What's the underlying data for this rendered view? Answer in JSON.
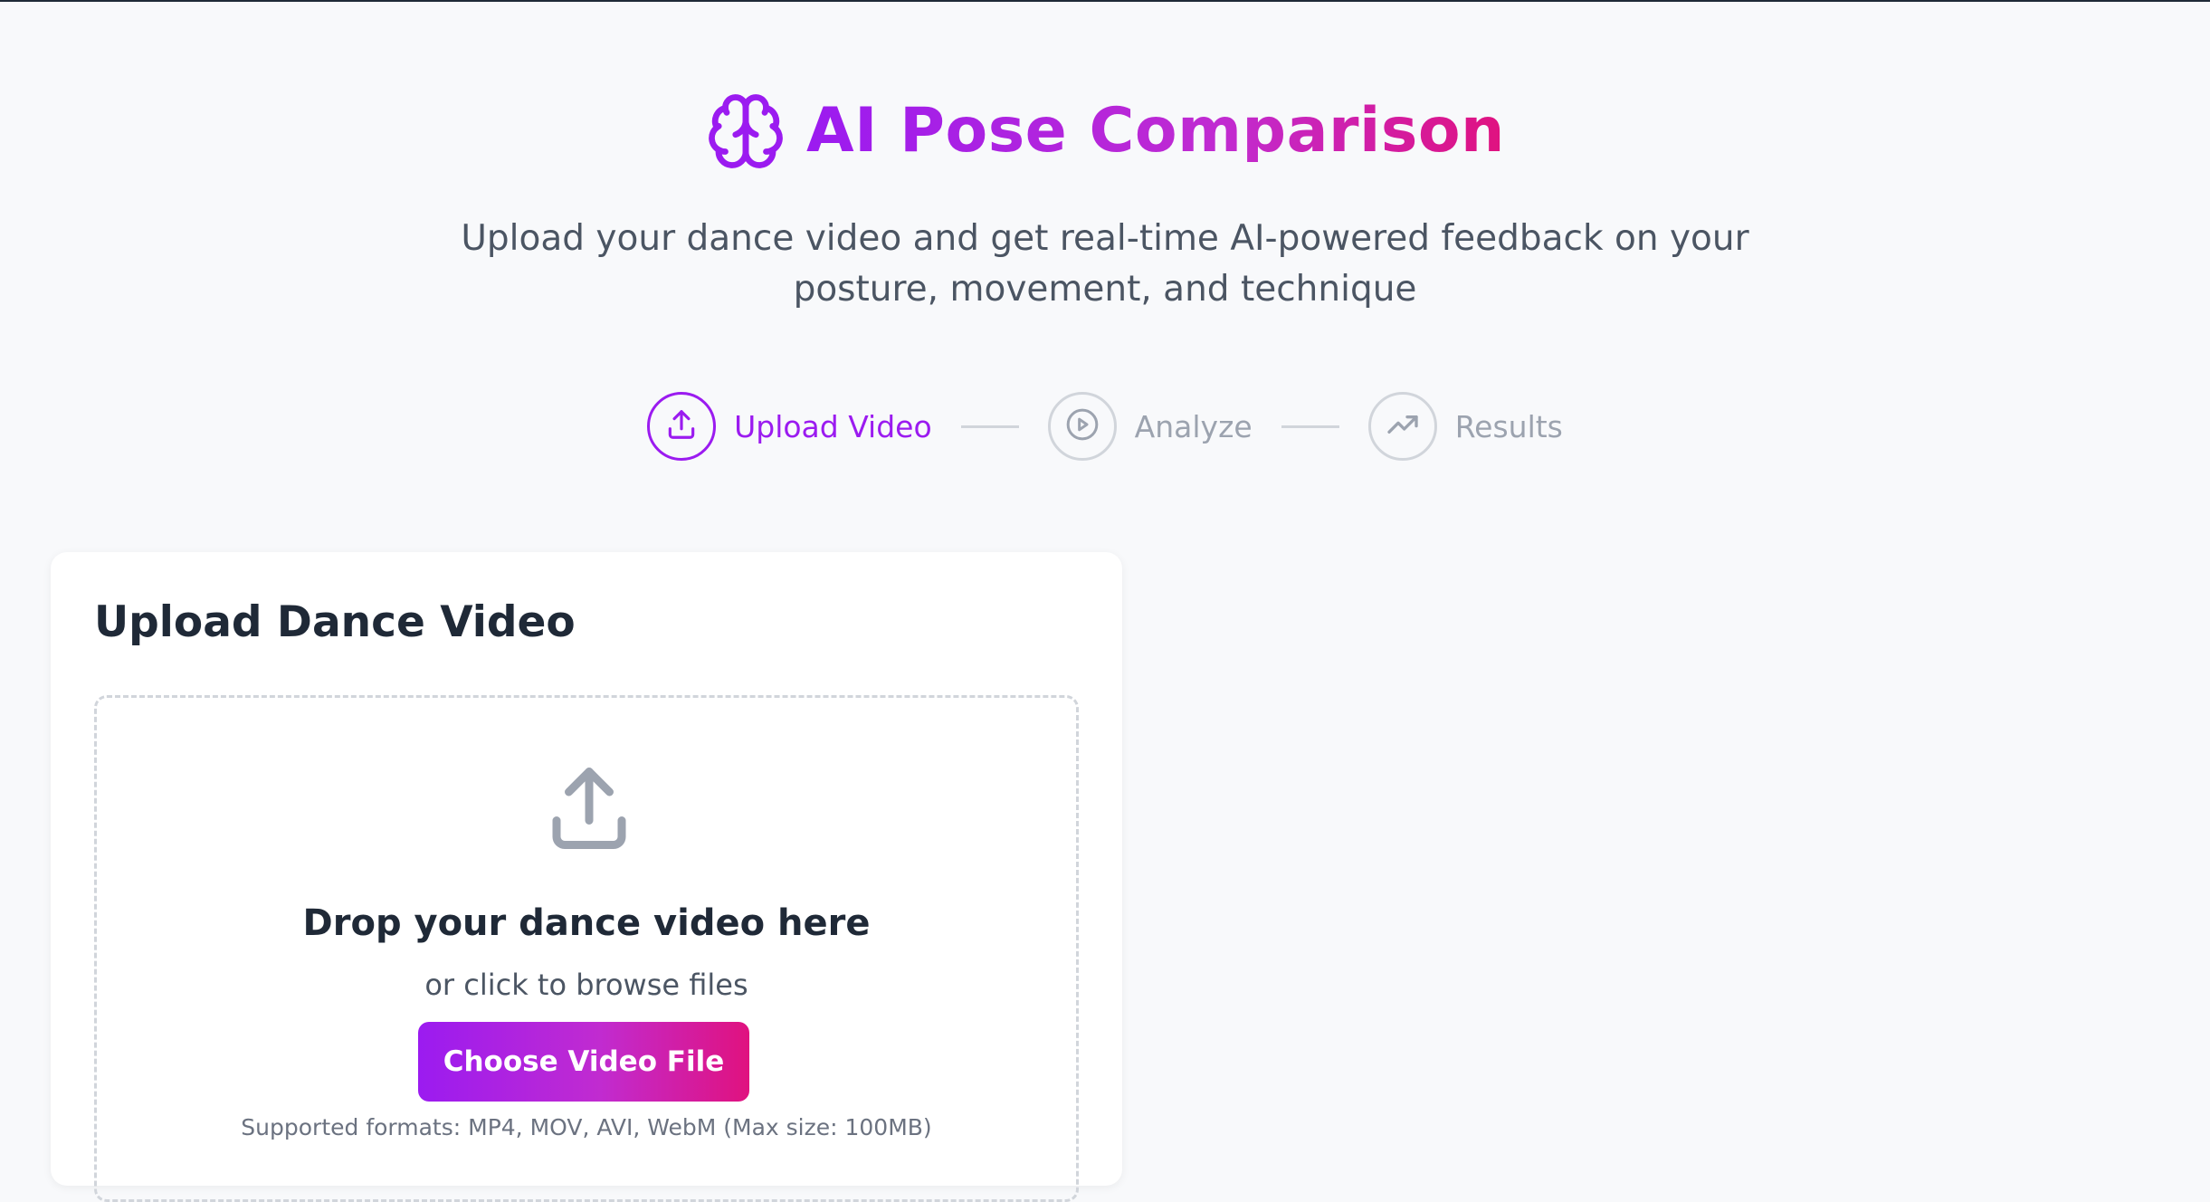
{
  "header": {
    "logo_icon": "brain-icon",
    "title": "AI Pose Comparison",
    "subtitle": "Upload your dance video and get real-time AI-powered feedback on your posture, movement, and technique",
    "accent_colors": [
      "#9b1bf0",
      "#c12bd0",
      "#e0127f"
    ]
  },
  "stepper": {
    "steps": [
      {
        "label": "Upload Video",
        "icon": "upload-icon",
        "state": "active"
      },
      {
        "label": "Analyze",
        "icon": "play-circle-icon",
        "state": "inactive"
      },
      {
        "label": "Results",
        "icon": "trending-up-icon",
        "state": "inactive"
      }
    ],
    "active_color": "#9b1bf0",
    "inactive_color": "#9ca3af"
  },
  "upload_card": {
    "title": "Upload Dance Video",
    "dropzone": {
      "icon": "upload-icon",
      "title": "Drop your dance video here",
      "subtitle": "or click to browse files",
      "button_label": "Choose Video File",
      "formats_note": "Supported formats: MP4, MOV, AVI, WebM (Max size: 100MB)"
    }
  }
}
